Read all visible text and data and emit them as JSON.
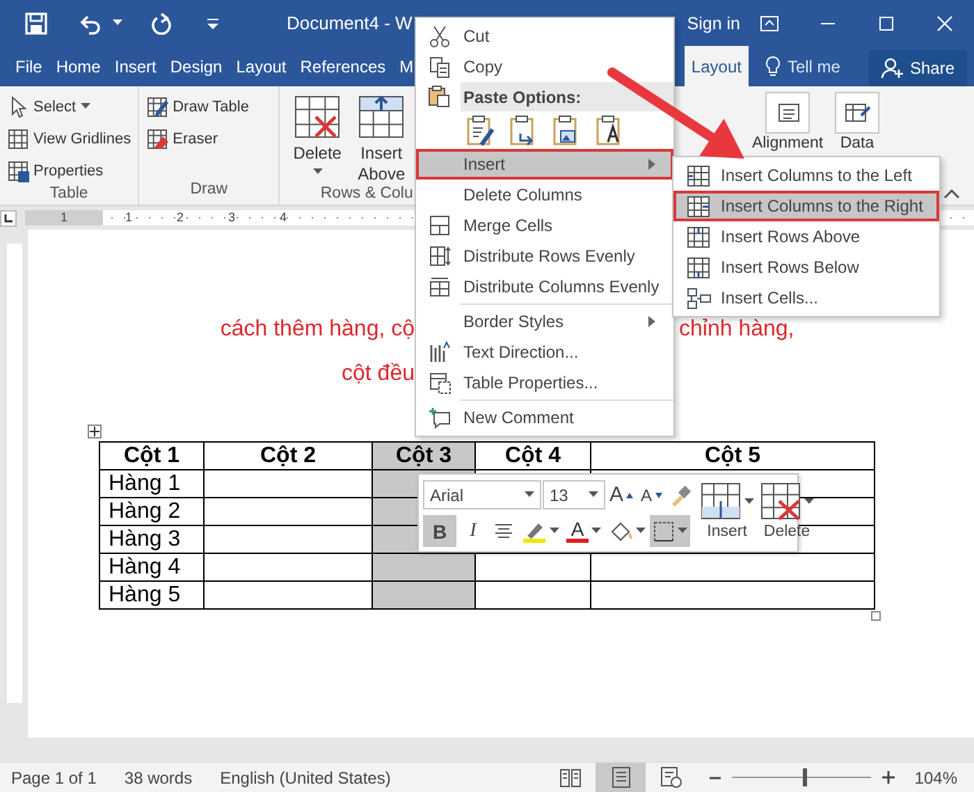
{
  "title_bar": {
    "title": "Document4 - W",
    "account": "Sign in"
  },
  "tabs": [
    {
      "label": "File",
      "selected": false
    },
    {
      "label": "Home",
      "selected": false
    },
    {
      "label": "Insert",
      "selected": false
    },
    {
      "label": "Design",
      "selected": false
    },
    {
      "label": "Layout",
      "selected": false
    },
    {
      "label": "References",
      "selected": false
    },
    {
      "label": "M",
      "selected": false
    },
    {
      "label": "Layout",
      "selected": true
    }
  ],
  "tell_me": "Tell me",
  "share": "Share",
  "ribbon": {
    "groups": [
      {
        "label": "Table",
        "items": [
          {
            "label": "Select",
            "kind": "small",
            "dropdown": true
          },
          {
            "label": "View Gridlines",
            "kind": "small",
            "dropdown": false
          },
          {
            "label": "Properties",
            "kind": "small",
            "dropdown": false
          }
        ]
      },
      {
        "label": "Draw",
        "items": [
          {
            "label": "Draw Table",
            "kind": "small",
            "dropdown": false
          },
          {
            "label": "Eraser",
            "kind": "small",
            "dropdown": false
          }
        ]
      },
      {
        "label": "Rows & Colu",
        "items": [
          {
            "label": "Delete",
            "kind": "large",
            "dropdown": true
          },
          {
            "label": "Insert Above",
            "kind": "large",
            "dropdown": false
          }
        ]
      }
    ],
    "right_items": [
      {
        "label": "Alignment"
      },
      {
        "label": "Data"
      }
    ]
  },
  "ruler": {
    "labels": [
      "1",
      "1",
      "2",
      "3",
      "4"
    ]
  },
  "document": {
    "heading_lines": [
      {
        "left": "cách thêm hàng, cộ",
        "right": "chỉnh hàng,"
      },
      {
        "left": "cột đều"
      }
    ]
  },
  "table": {
    "columns": [
      {
        "label": "Cột 1",
        "selected": false
      },
      {
        "label": "Cột 2",
        "selected": false
      },
      {
        "label": "Cột 3",
        "selected": true
      },
      {
        "label": "Cột 4",
        "selected": false
      },
      {
        "label": "Cột 5",
        "selected": false
      }
    ],
    "rows": [
      {
        "label": "Hàng 1"
      },
      {
        "label": "Hàng 2"
      },
      {
        "label": "Hàng 3"
      },
      {
        "label": "Hàng 4"
      },
      {
        "label": "Hàng 5"
      }
    ]
  },
  "context_menu": {
    "items": [
      {
        "kind": "item",
        "label": "Cut",
        "selected": false,
        "submenu": false
      },
      {
        "kind": "item",
        "label": "Copy",
        "selected": false,
        "submenu": false
      },
      {
        "kind": "header",
        "label": "Paste Options:"
      },
      {
        "kind": "paste_icons"
      },
      {
        "kind": "item",
        "label": "Insert",
        "selected": true,
        "submenu": true
      },
      {
        "kind": "item",
        "label": "Delete Columns",
        "selected": false,
        "submenu": false
      },
      {
        "kind": "item",
        "label": "Merge Cells",
        "selected": false,
        "submenu": false
      },
      {
        "kind": "item",
        "label": "Distribute Rows Evenly",
        "selected": false,
        "submenu": false
      },
      {
        "kind": "item",
        "label": "Distribute Columns Evenly",
        "selected": false,
        "submenu": false
      },
      {
        "kind": "separator"
      },
      {
        "kind": "item",
        "label": "Border Styles",
        "selected": false,
        "submenu": true
      },
      {
        "kind": "item",
        "label": "Text Direction...",
        "selected": false,
        "submenu": false
      },
      {
        "kind": "item",
        "label": "Table Properties...",
        "selected": false,
        "submenu": false
      },
      {
        "kind": "separator"
      },
      {
        "kind": "item",
        "label": "New Comment",
        "selected": false,
        "submenu": false
      }
    ]
  },
  "submenu": {
    "items": [
      {
        "label": "Insert Columns to the Left",
        "selected": false
      },
      {
        "label": "Insert Columns to the Right",
        "selected": true
      },
      {
        "label": "Insert Rows Above",
        "selected": false
      },
      {
        "label": "Insert Rows Below",
        "selected": false
      },
      {
        "label": "Insert Cells...",
        "selected": false
      }
    ]
  },
  "mini_toolbar": {
    "font": "Arial",
    "size": "13",
    "grow_glyph": "A",
    "shrink_glyph": "A",
    "bold": {
      "glyph": "B",
      "pressed": true
    },
    "italic": {
      "glyph": "I",
      "pressed": false
    },
    "font_color_glyph": "A",
    "borders_pressed": true,
    "insert": "Insert",
    "delete": "Delete"
  },
  "status_bar": {
    "page": "Page 1 of 1",
    "words": "38 words",
    "language": "English (United States)",
    "views": [
      {
        "selected": false
      },
      {
        "selected": true
      },
      {
        "selected": false
      }
    ],
    "zoom": {
      "level": 0.52
    },
    "zoom_reading": "104%"
  }
}
